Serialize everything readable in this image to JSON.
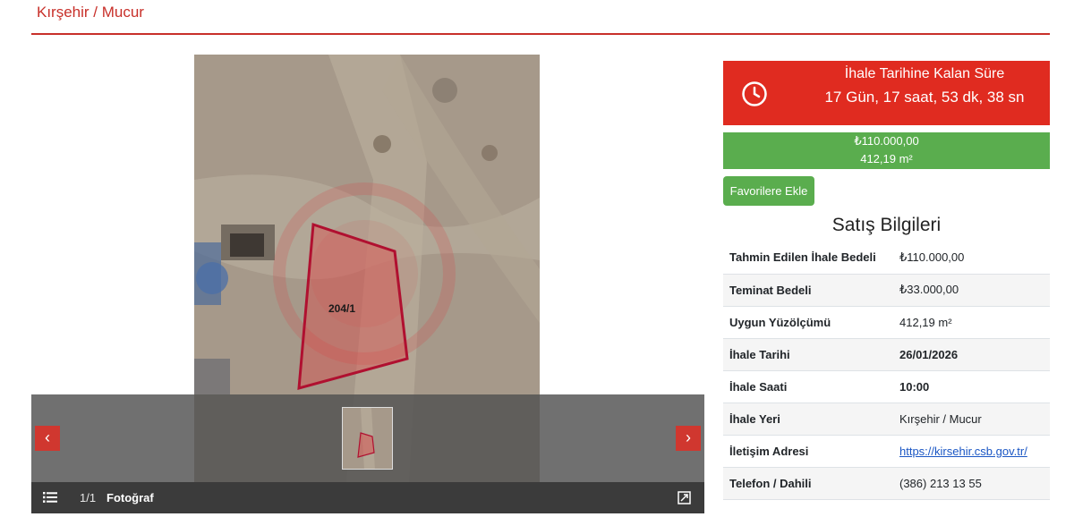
{
  "page": {
    "title": "Kırşehir / Mucur"
  },
  "gallery": {
    "parcel_label": "204/1",
    "counter": "1/1",
    "photo_label": "Fotoğraf",
    "prev_symbol": "‹",
    "next_symbol": "›",
    "icons": [
      "list-icon",
      "expand-icon",
      "chevron-left-icon",
      "chevron-right-icon"
    ]
  },
  "countdown": {
    "title": "İhale Tarihine Kalan Süre",
    "value": "17 Gün, 17 saat, 53 dk, 38 sn",
    "icon": "clock-icon",
    "color": "#e02b20"
  },
  "price": {
    "amount": "₺110.000,00",
    "area": "412,19 m²",
    "color": "#5aad4e"
  },
  "favorite_button": {
    "label": "Favorilere Ekle"
  },
  "sale_info": {
    "title": "Satış Bilgileri",
    "rows": [
      {
        "key": "Tahmin Edilen İhale Bedeli",
        "value": "₺110.000,00"
      },
      {
        "key": "Teminat Bedeli",
        "value": "₺33.000,00"
      },
      {
        "key": "Uygun Yüzölçümü",
        "value": "412,19 m²"
      },
      {
        "key": "İhale Tarihi",
        "value": "26/01/2026"
      },
      {
        "key": "İhale Saati",
        "value": "10:00"
      },
      {
        "key": "İhale Yeri",
        "value": "Kırşehir / Mucur"
      },
      {
        "key": "İletişim Adresi",
        "value": "https://kirsehir.csb.gov.tr/"
      },
      {
        "key": "Telefon / Dahili",
        "value": "(386) 213 13 55"
      }
    ]
  },
  "accent_color": "#c8302a"
}
